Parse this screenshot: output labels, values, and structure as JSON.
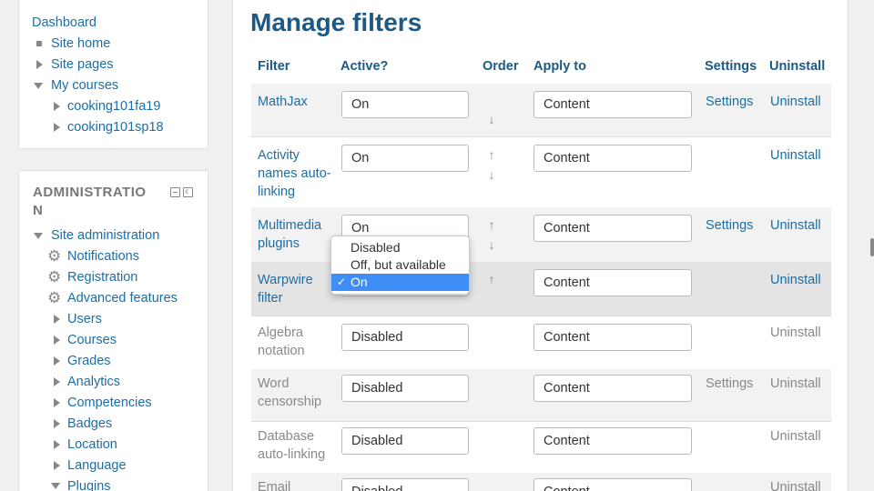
{
  "nav": {
    "dashboard": "Dashboard",
    "site_home": "Site home",
    "site_pages": "Site pages",
    "my_courses": "My courses",
    "courses": [
      "cooking101fa19",
      "cooking101sp18"
    ]
  },
  "admin": {
    "title": "ADMINISTRATION",
    "site_admin": "Site administration",
    "items": [
      {
        "label": "Notifications",
        "icon": "gear-icon"
      },
      {
        "label": "Registration",
        "icon": "gear-icon"
      },
      {
        "label": "Advanced features",
        "icon": "gear-icon"
      },
      {
        "label": "Users",
        "icon": "triangle-right-icon"
      },
      {
        "label": "Courses",
        "icon": "triangle-right-icon"
      },
      {
        "label": "Grades",
        "icon": "triangle-right-icon"
      },
      {
        "label": "Analytics",
        "icon": "triangle-right-icon"
      },
      {
        "label": "Competencies",
        "icon": "triangle-right-icon"
      },
      {
        "label": "Badges",
        "icon": "triangle-right-icon"
      },
      {
        "label": "Location",
        "icon": "triangle-right-icon"
      },
      {
        "label": "Language",
        "icon": "triangle-right-icon"
      },
      {
        "label": "Plugins",
        "icon": "triangle-down-icon"
      }
    ]
  },
  "page": {
    "title": "Manage filters"
  },
  "table": {
    "headers": {
      "filter": "Filter",
      "active": "Active?",
      "order": "Order",
      "apply": "Apply to",
      "settings": "Settings",
      "uninstall": "Uninstall"
    },
    "rows": [
      {
        "name": "MathJax",
        "active": "On",
        "apply": "Content",
        "settings": "Settings",
        "uninstall": "Uninstall"
      },
      {
        "name": "Activity names auto-linking",
        "active": "On",
        "apply": "Content",
        "settings": "",
        "uninstall": "Uninstall"
      },
      {
        "name": "Multimedia plugins",
        "active": "On",
        "apply": "Content",
        "settings": "Settings",
        "uninstall": "Uninstall"
      },
      {
        "name": "Warpwire filter",
        "active": "On",
        "apply": "Content",
        "settings": "",
        "uninstall": "Uninstall"
      },
      {
        "name": "Algebra notation",
        "active": "Disabled",
        "apply": "Content",
        "settings": "",
        "uninstall": "Uninstall"
      },
      {
        "name": "Word censorship",
        "active": "Disabled",
        "apply": "Content",
        "settings": "Settings",
        "uninstall": "Uninstall"
      },
      {
        "name": "Database auto-linking",
        "active": "Disabled",
        "apply": "Content",
        "settings": "",
        "uninstall": "Uninstall"
      },
      {
        "name": "Email",
        "active": "Disabled",
        "apply": "Content",
        "settings": "",
        "uninstall": "Uninstall"
      }
    ]
  },
  "dropdown": {
    "options": [
      "Disabled",
      "Off, but available",
      "On"
    ],
    "selected": "On",
    "checkmark": "✓"
  },
  "icons": {
    "up": "arrow-up-icon",
    "down": "arrow-down-icon"
  },
  "colors": {
    "link": "#1c6ea4",
    "heading": "#1c5a85",
    "selected": "#3f8ef7",
    "muted": "#888888"
  }
}
